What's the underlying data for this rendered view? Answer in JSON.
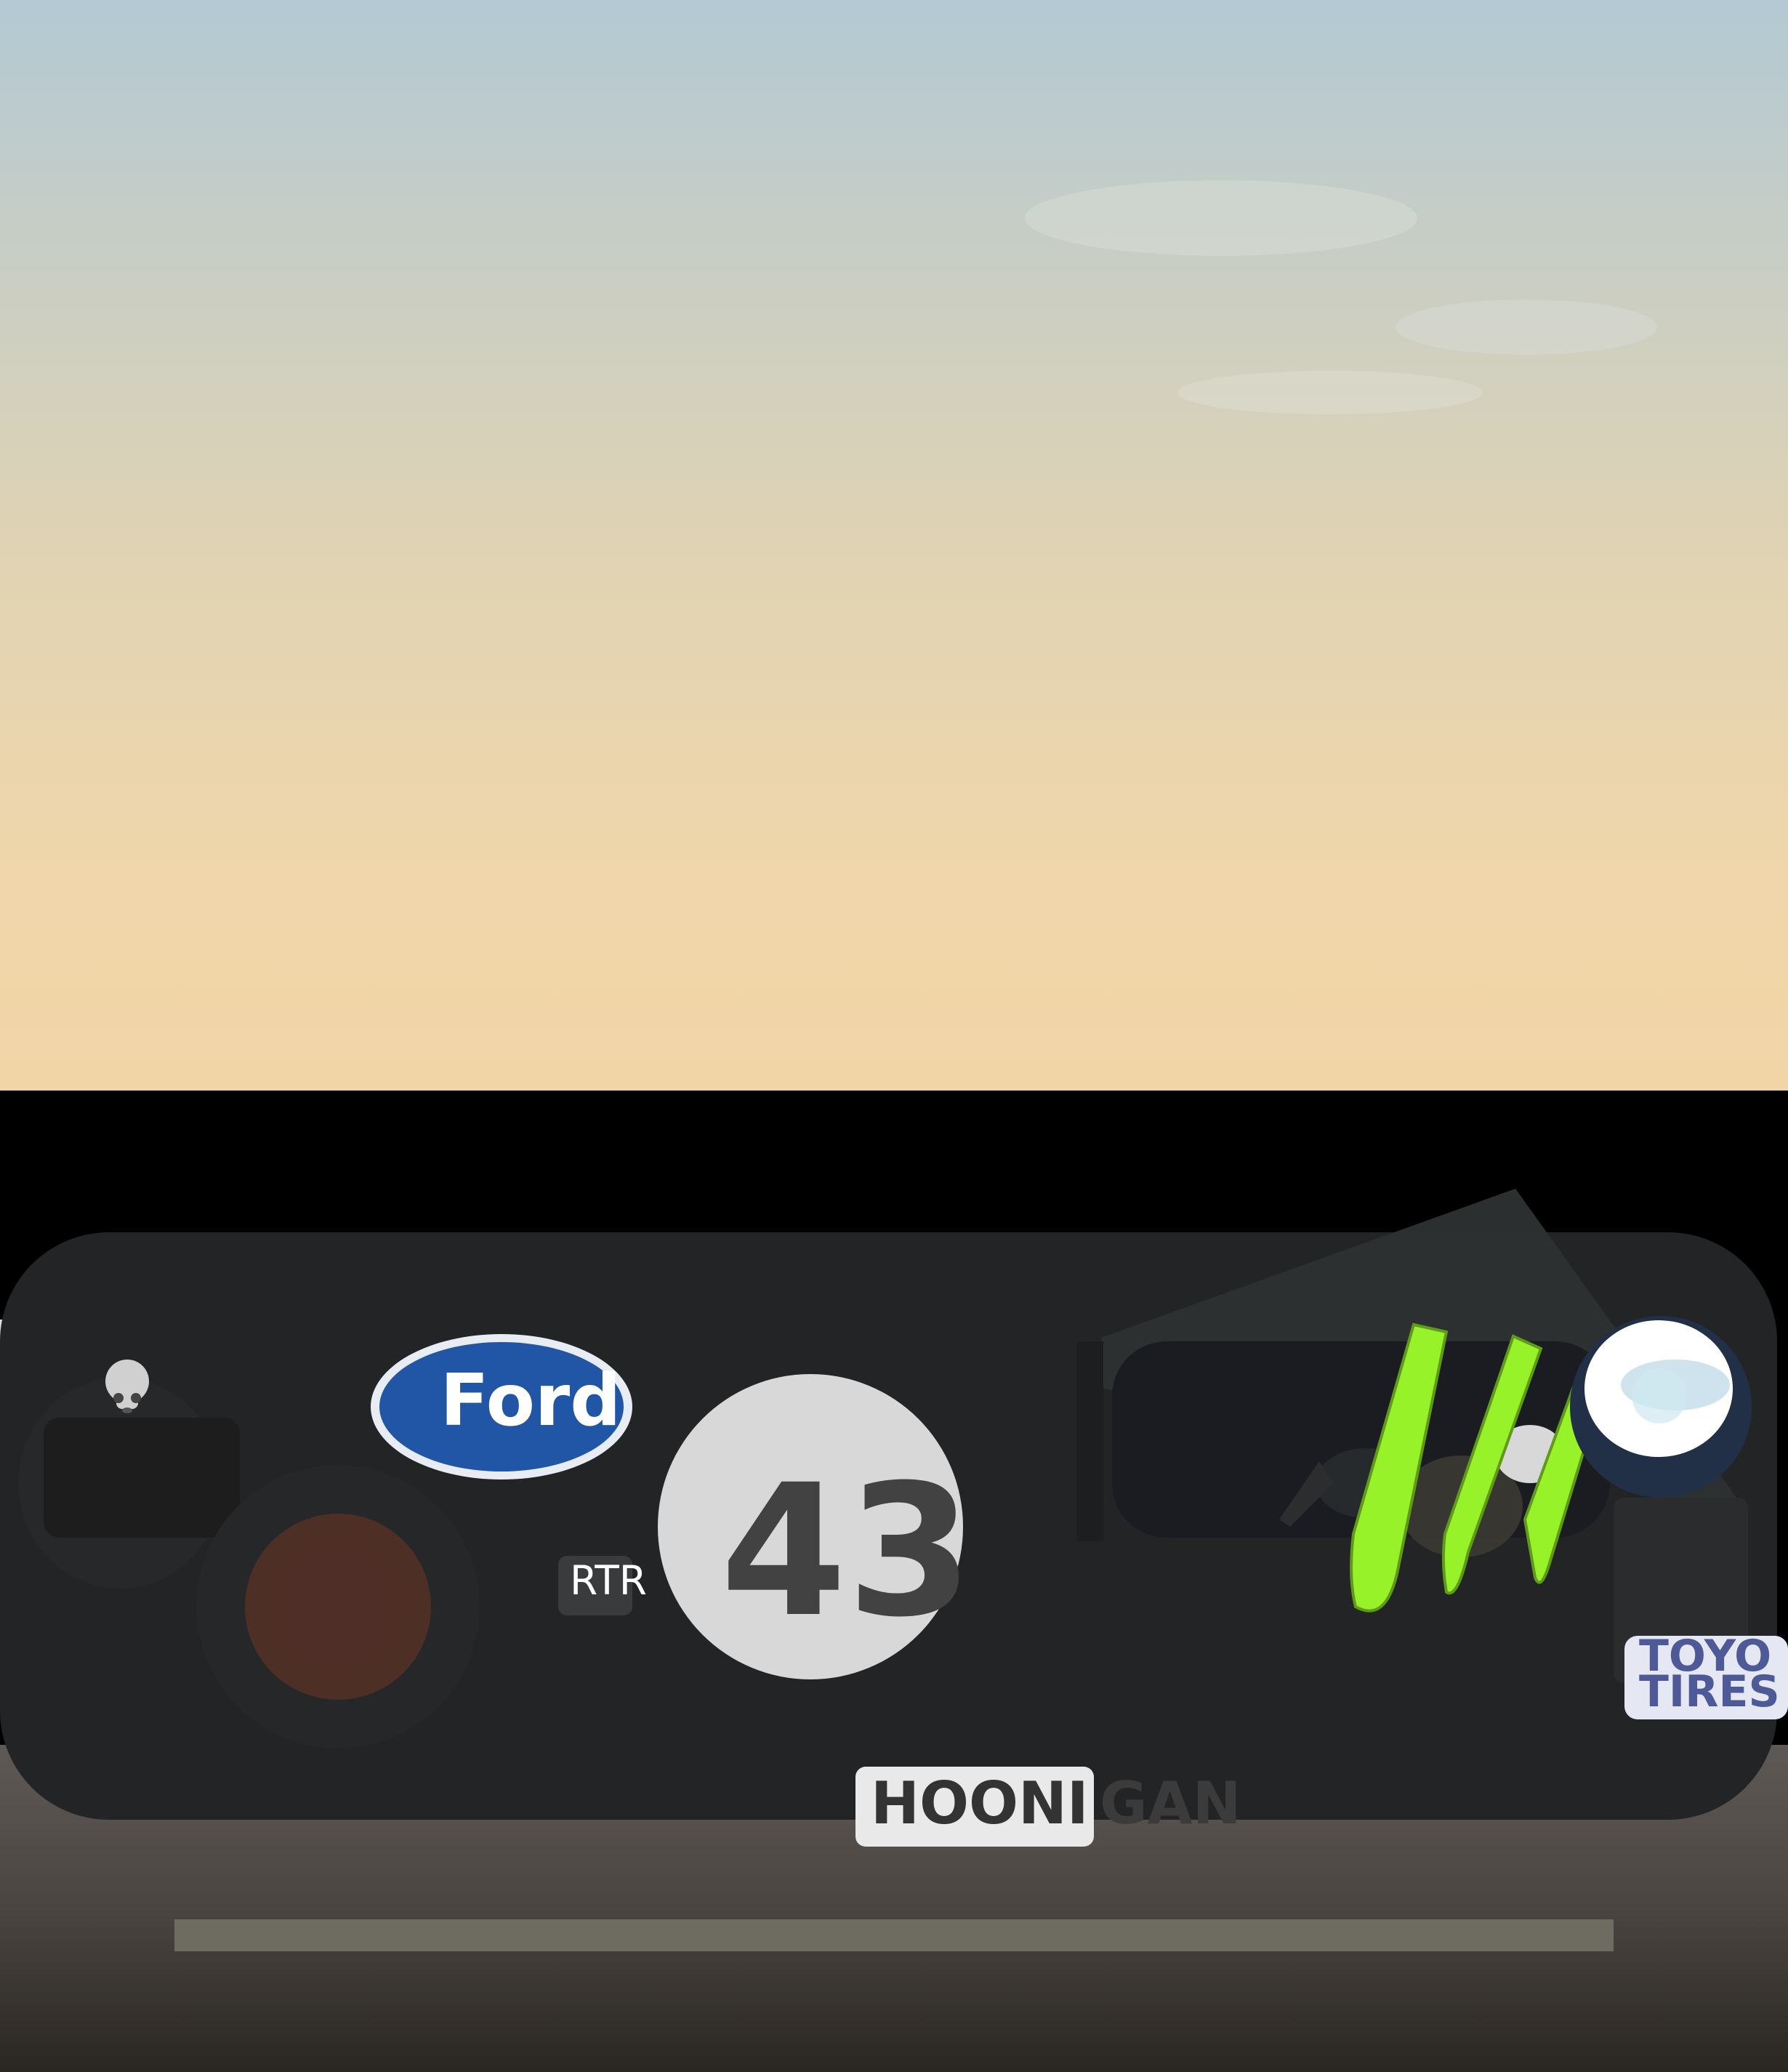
{
  "decals": {
    "brand": "Ford",
    "number": "43",
    "rtr": "RTR",
    "hoonigan_part1": "HOONI",
    "hoonigan_part2": "GAN",
    "toyo_line1": "TOYO",
    "toyo_line2": "TIRES"
  },
  "colors": {
    "sky_top": "#b3c9d3",
    "sky_bottom": "#f2d5a7",
    "body": "#222426",
    "ford_blue": "#2155a5",
    "monster_green": "#97f22a",
    "number_circle": "#d8d8d8",
    "toyo_blue": "#4e5a97",
    "road": "#5a5551"
  },
  "icons": [
    "skull-icon",
    "monster-claw-icon"
  ]
}
